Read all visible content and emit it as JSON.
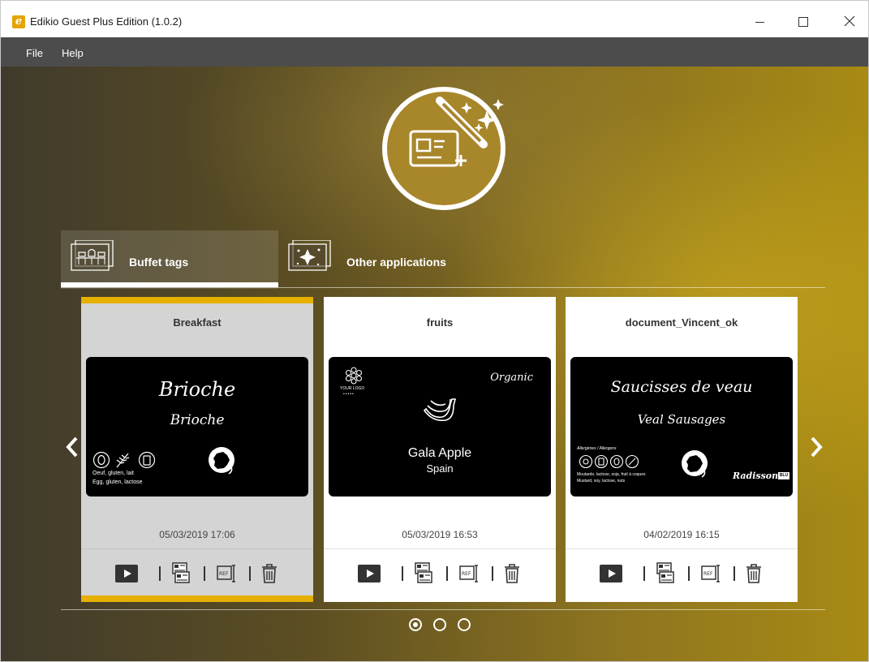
{
  "window": {
    "title": "Edikio Guest Plus Edition (1.0.2)",
    "app_icon_letter": "e",
    "accent_color": "#e5b000"
  },
  "menu": {
    "items": [
      "File",
      "Help"
    ]
  },
  "hero": {
    "icon": "magic-wand-card-icon"
  },
  "tabs": [
    {
      "label": "Buffet tags",
      "icon": "buffet-icon",
      "active": true
    },
    {
      "label": "Other applications",
      "icon": "sparkle-card-icon",
      "active": false
    }
  ],
  "cards": [
    {
      "title": "Breakfast",
      "date": "05/03/2019 17:06",
      "selected": true,
      "label": {
        "line1": "Brioche",
        "line2": "Brioche",
        "allergens_fr": "Oeuf, gluten, lait",
        "allergens_en": "Egg, gluten, lactose",
        "flag": "france-flag-icon"
      }
    },
    {
      "title": "fruits",
      "date": "05/03/2019 16:53",
      "selected": false,
      "label": {
        "logo_text": "YOUR LOGO",
        "badge": "Organic",
        "name": "Gala Apple",
        "origin": "Spain",
        "picture": "banana-icon"
      }
    },
    {
      "title": "document_Vincent_ok",
      "date": "04/02/2019 16:15",
      "selected": false,
      "label": {
        "line1": "Saucisses de veau",
        "line2": "Veal Sausages",
        "allergen_heading": "Allergènes / Allergens",
        "allergens_fr": "Moutarde, lactose, soja, fruit à coques",
        "allergens_en": "Mustard, soy, lactose, nuts",
        "brand": "Radisson",
        "brand_badge": "BLU",
        "flag": "france-flag-icon"
      }
    }
  ],
  "card_actions": [
    "play-icon",
    "duplicate-icon",
    "reference-icon",
    "trash-icon"
  ],
  "pagination": {
    "pages": 3,
    "current": 1
  }
}
